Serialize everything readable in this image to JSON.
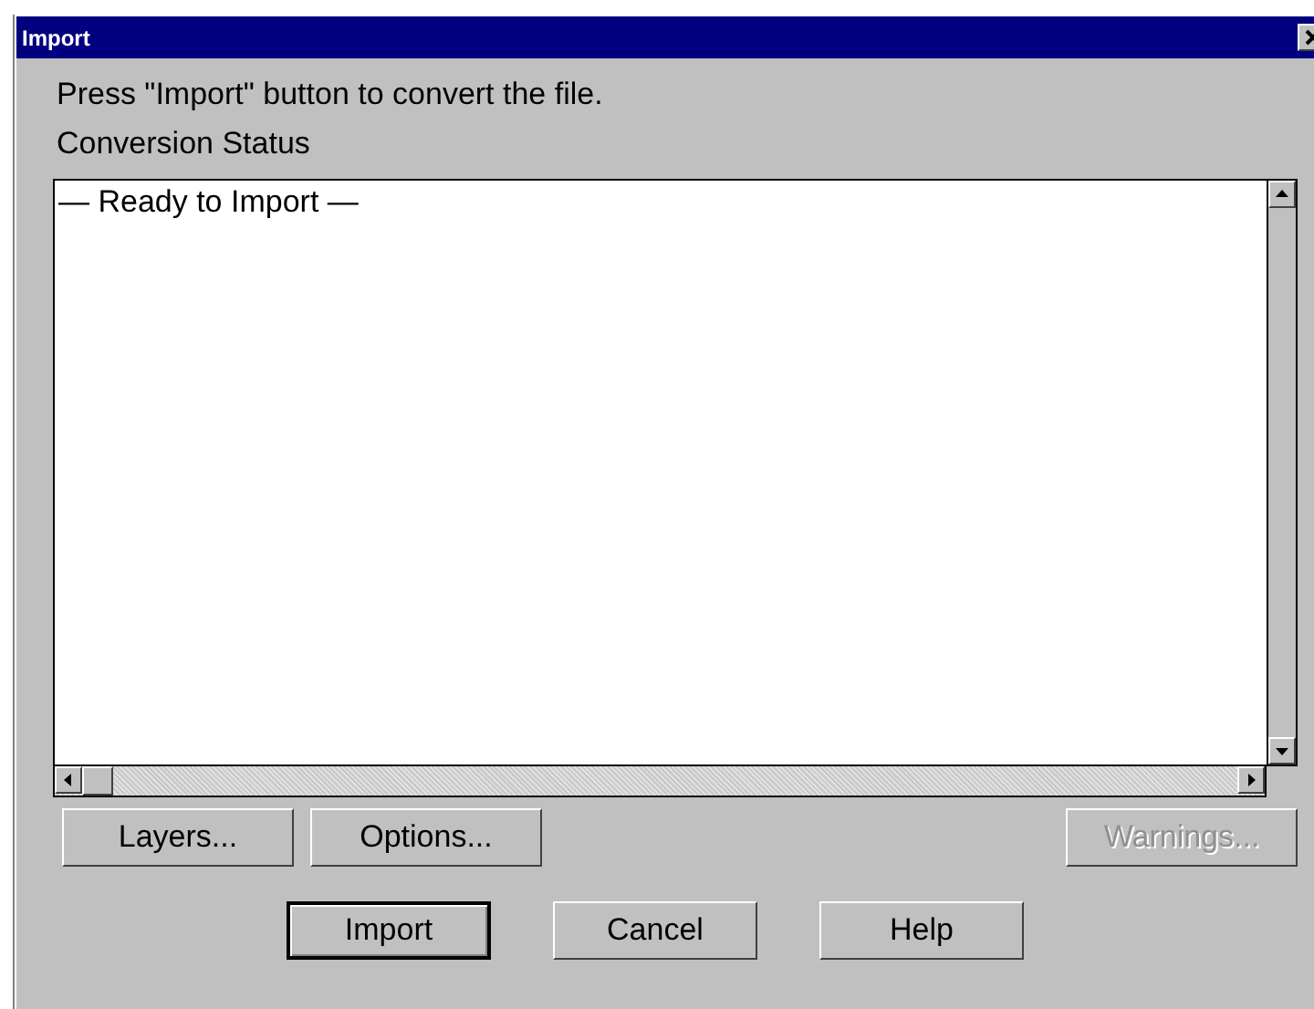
{
  "window": {
    "title": "Import"
  },
  "instruction": "Press \"Import\" button to convert the file.",
  "status_label": "Conversion Status",
  "status_lines": [
    "— Ready to Import —"
  ],
  "tool_buttons": [
    {
      "label": "Layers...",
      "disabled": false
    },
    {
      "label": "Options...",
      "disabled": false
    },
    {
      "label": "Warnings...",
      "disabled": true
    }
  ],
  "dialog_buttons": [
    {
      "label": "Import",
      "default": true
    },
    {
      "label": "Cancel",
      "default": false
    },
    {
      "label": "Help",
      "default": false
    }
  ]
}
